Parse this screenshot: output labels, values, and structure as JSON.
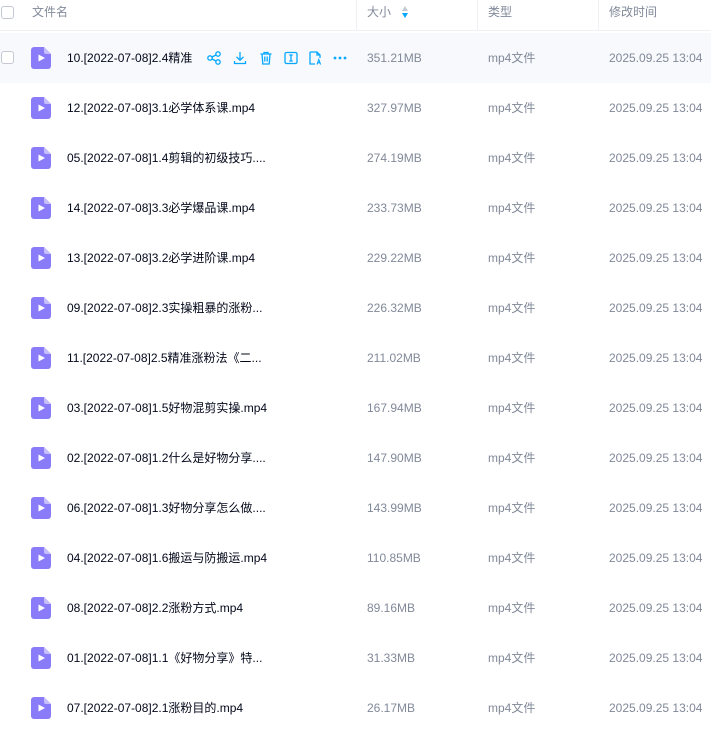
{
  "header": {
    "name_label": "文件名",
    "size_label": "大小",
    "type_label": "类型",
    "modified_label": "修改时间"
  },
  "colors": {
    "accent": "#06a7ff",
    "file_icon": "#8a7cf8",
    "muted_text": "#818999",
    "row_hover": "#f7f9fc"
  },
  "row_actions": [
    "share-icon",
    "download-icon",
    "delete-icon",
    "rename-icon",
    "ai-icon",
    "more-icon"
  ],
  "files": [
    {
      "name": "10.[2022-07-08]2.4精准",
      "size": "351.21MB",
      "type": "mp4文件",
      "modified": "2025.09.25 13:04"
    },
    {
      "name": "12.[2022-07-08]3.1必学体系课.mp4",
      "size": "327.97MB",
      "type": "mp4文件",
      "modified": "2025.09.25 13:04"
    },
    {
      "name": "05.[2022-07-08]1.4剪辑的初级技巧....",
      "size": "274.19MB",
      "type": "mp4文件",
      "modified": "2025.09.25 13:04"
    },
    {
      "name": "14.[2022-07-08]3.3必学爆品课.mp4",
      "size": "233.73MB",
      "type": "mp4文件",
      "modified": "2025.09.25 13:04"
    },
    {
      "name": "13.[2022-07-08]3.2必学进阶课.mp4",
      "size": "229.22MB",
      "type": "mp4文件",
      "modified": "2025.09.25 13:04"
    },
    {
      "name": "09.[2022-07-08]2.3实操粗暴的涨粉...",
      "size": "226.32MB",
      "type": "mp4文件",
      "modified": "2025.09.25 13:04"
    },
    {
      "name": "11.[2022-07-08]2.5精准涨粉法《二...",
      "size": "211.02MB",
      "type": "mp4文件",
      "modified": "2025.09.25 13:04"
    },
    {
      "name": "03.[2022-07-08]1.5好物混剪实操.mp4",
      "size": "167.94MB",
      "type": "mp4文件",
      "modified": "2025.09.25 13:04"
    },
    {
      "name": "02.[2022-07-08]1.2什么是好物分享....",
      "size": "147.90MB",
      "type": "mp4文件",
      "modified": "2025.09.25 13:04"
    },
    {
      "name": "06.[2022-07-08]1.3好物分享怎么做....",
      "size": "143.99MB",
      "type": "mp4文件",
      "modified": "2025.09.25 13:04"
    },
    {
      "name": "04.[2022-07-08]1.6搬运与防搬运.mp4",
      "size": "110.85MB",
      "type": "mp4文件",
      "modified": "2025.09.25 13:04"
    },
    {
      "name": "08.[2022-07-08]2.2涨粉方式.mp4",
      "size": "89.16MB",
      "type": "mp4文件",
      "modified": "2025.09.25 13:04"
    },
    {
      "name": "01.[2022-07-08]1.1《好物分享》特...",
      "size": "31.33MB",
      "type": "mp4文件",
      "modified": "2025.09.25 13:04"
    },
    {
      "name": "07.[2022-07-08]2.1涨粉目的.mp4",
      "size": "26.17MB",
      "type": "mp4文件",
      "modified": "2025.09.25 13:04"
    }
  ]
}
